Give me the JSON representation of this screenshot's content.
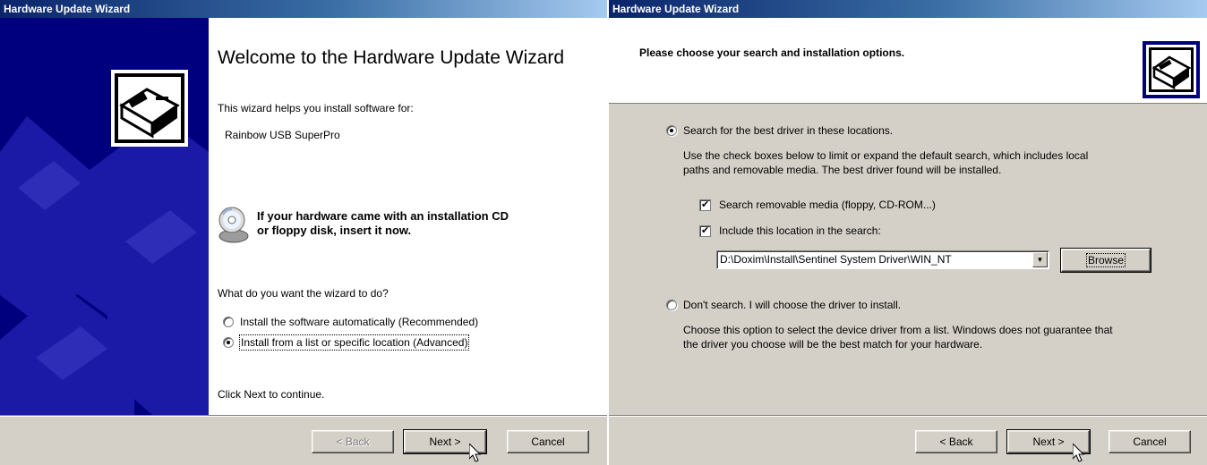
{
  "window1": {
    "title": "Hardware Update Wizard",
    "heading": "Welcome to the Hardware Update Wizard",
    "intro": "This wizard helps you install software for:",
    "device_name": "Rainbow USB SuperPro",
    "cd_prompt_line1": "If your hardware came with an installation CD",
    "cd_prompt_line2": "or floppy disk, insert it now.",
    "question": "What do you want the wizard to do?",
    "options": [
      {
        "label": "Install the software automatically (Recommended)",
        "selected": false
      },
      {
        "label": "Install from a list or specific location (Advanced)",
        "selected": true
      }
    ],
    "footer_text": "Click Next to continue.",
    "buttons": {
      "back": "< Back",
      "next": "Next >",
      "cancel": "Cancel"
    }
  },
  "window2": {
    "title": "Hardware Update Wizard",
    "header": "Please choose your search and installation options.",
    "option_search": "Search for the best driver in these locations.",
    "search_desc_line1": "Use the check boxes below to limit or expand the default search, which includes local",
    "search_desc_line2": "paths and removable media. The best driver found will be installed.",
    "check_removable": "Search removable media (floppy, CD-ROM...)",
    "check_location": "Include this location in the search:",
    "location_value": "D:\\Doxim\\Install\\Sentinel System Driver\\WIN_NT",
    "browse_label": "Browse",
    "option_dont_search": "Don't search. I will choose the driver to install.",
    "dont_desc_line1": "Choose this option to select the device driver from a list.  Windows does not guarantee that",
    "dont_desc_line2": "the driver you choose will be the best match for your hardware.",
    "buttons": {
      "back": "< Back",
      "next": "Next >",
      "cancel": "Cancel"
    }
  },
  "colors": {
    "title_bar": "#0a246a",
    "side_panel": "#00007e",
    "dialog_face": "#d4d0c8"
  },
  "icons": [
    "hardware-wizard-icon",
    "cd-icon",
    "mouse-pointer-icon"
  ]
}
